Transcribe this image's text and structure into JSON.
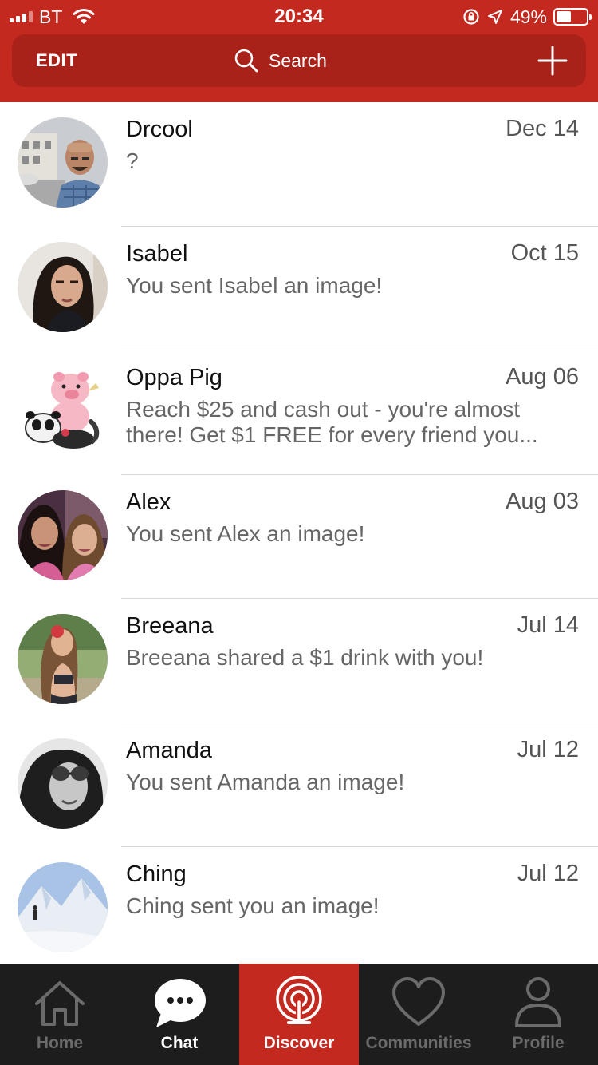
{
  "status_bar": {
    "carrier": "BT",
    "time": "20:34",
    "battery_percent": "49%",
    "battery_level": 0.49
  },
  "nav": {
    "edit_label": "EDIT",
    "search_label": "Search",
    "add_icon": "plus-icon"
  },
  "chats": [
    {
      "name": "Drcool",
      "date": "Dec 14",
      "preview": "?"
    },
    {
      "name": "Isabel",
      "date": "Oct 15",
      "preview": "You sent Isabel an image!"
    },
    {
      "name": "Oppa Pig",
      "date": "Aug 06",
      "preview": "Reach $25 and cash out - you're almost there! Get $1 FREE for every friend you..."
    },
    {
      "name": "Alex",
      "date": "Aug 03",
      "preview": "You sent Alex an image!"
    },
    {
      "name": "Breeana",
      "date": "Jul 14",
      "preview": "Breeana shared a $1 drink with you!"
    },
    {
      "name": "Amanda",
      "date": "Jul 12",
      "preview": "You sent Amanda an image!"
    },
    {
      "name": "Ching",
      "date": "Jul 12",
      "preview": "Ching sent you an image!"
    }
  ],
  "tabs": [
    {
      "label": "Home",
      "icon": "home-icon"
    },
    {
      "label": "Chat",
      "icon": "chat-bubble-icon"
    },
    {
      "label": "Discover",
      "icon": "broadcast-icon"
    },
    {
      "label": "Communities",
      "icon": "heart-icon"
    },
    {
      "label": "Profile",
      "icon": "person-icon"
    }
  ],
  "colors": {
    "brand_red": "#c4291f",
    "nav_dark_red": "#a8221a",
    "tab_bar_bg": "#1d1d1d"
  }
}
